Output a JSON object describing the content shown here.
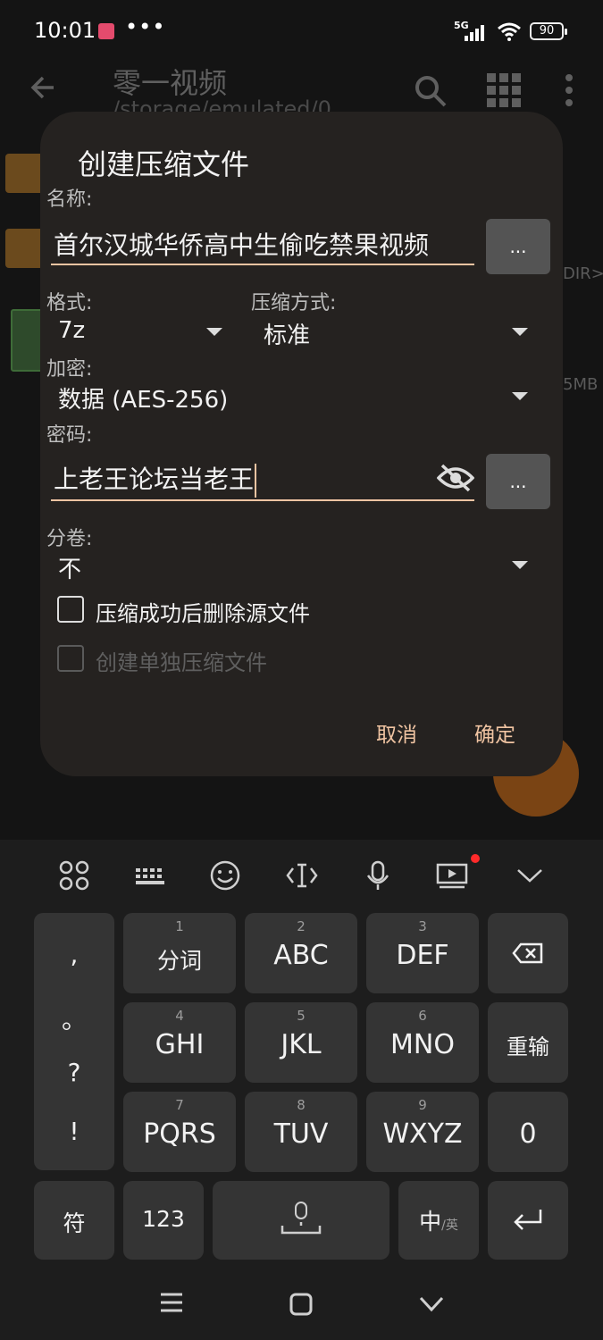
{
  "status_bar": {
    "time": "10:01",
    "dots": "•••",
    "network": "5G",
    "battery": "90",
    "icons": [
      "app-notification-icon",
      "signal-icon",
      "wifi-icon",
      "battery-icon"
    ]
  },
  "toolbar": {
    "title": "零一视频",
    "path": "/storage/emulated/0",
    "icons": [
      "back-arrow-icon",
      "search-icon",
      "grid-view-icon",
      "more-vert-icon"
    ]
  },
  "background_list": {
    "dir_suffix": "DIR>",
    "size_suffix": "5MB"
  },
  "dialog": {
    "title": "创建压缩文件",
    "name_label": "名称:",
    "name_value": "首尔汉城华侨高中生偷吃禁果视频",
    "browse_label": "...",
    "format_label": "格式:",
    "format_value": "7z",
    "compression_label": "压缩方式:",
    "compression_value": "标准",
    "encryption_label": "加密:",
    "encryption_value": "数据 (AES-256)",
    "password_label": "密码:",
    "password_value": "上老王论坛当老王",
    "password_browse_label": "...",
    "split_label": "分卷:",
    "split_value": "不",
    "delete_source_label": "压缩成功后删除源文件",
    "separate_archives_label": "创建单独压缩文件",
    "cancel_label": "取消",
    "ok_label": "确定",
    "accent_color": "#f0c4a2"
  },
  "keyboard": {
    "toolbar_icons": [
      "apps-icon",
      "keyboard-icon",
      "emoji-icon",
      "cursor-move-icon",
      "microphone-icon",
      "screen-record-icon",
      "collapse-icon"
    ],
    "left_column": [
      ",",
      "。",
      "?",
      "!"
    ],
    "keys": [
      {
        "num": "1",
        "label": "分词"
      },
      {
        "num": "2",
        "label": "ABC"
      },
      {
        "num": "3",
        "label": "DEF"
      },
      {
        "num": "4",
        "label": "GHI"
      },
      {
        "num": "5",
        "label": "JKL"
      },
      {
        "num": "6",
        "label": "MNO"
      },
      {
        "num": "7",
        "label": "PQRS"
      },
      {
        "num": "8",
        "label": "TUV"
      },
      {
        "num": "9",
        "label": "WXYZ"
      }
    ],
    "right_keys": {
      "reinput": "重输",
      "zero": "0"
    },
    "bottom_row": {
      "symbols": "符",
      "numbers": "123",
      "lang_main": "中",
      "lang_sub": "/英"
    }
  },
  "navbar": {
    "icons": [
      "menu-icon",
      "home-icon",
      "back-icon"
    ]
  }
}
